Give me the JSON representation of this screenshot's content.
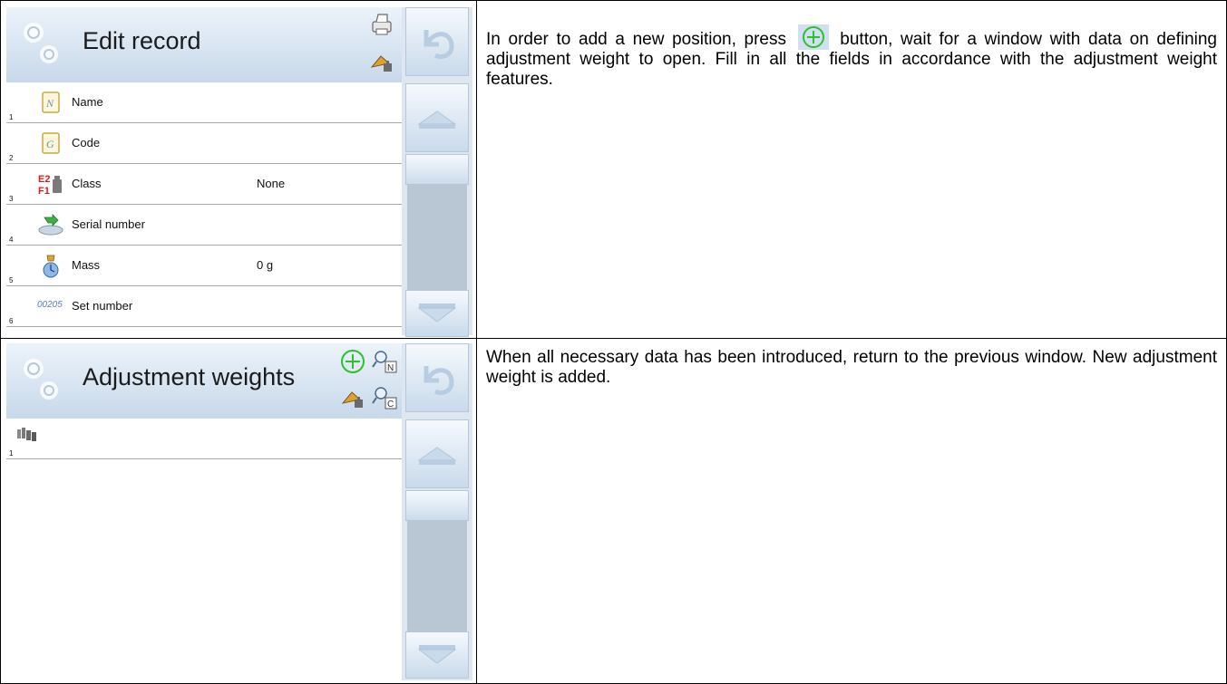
{
  "sections": [
    {
      "screen": {
        "title": "Edit record",
        "header_icons": [
          "printer-icon",
          "weights-settings-icon"
        ],
        "rows": [
          {
            "num": "1",
            "icon": "name-icon",
            "label": "Name",
            "value": ""
          },
          {
            "num": "2",
            "icon": "code-icon",
            "label": "Code",
            "value": ""
          },
          {
            "num": "3",
            "icon": "class-e2-f1-icon",
            "label": "Class",
            "value": "None"
          },
          {
            "num": "4",
            "icon": "serial-number-icon",
            "label": "Serial number",
            "value": ""
          },
          {
            "num": "5",
            "icon": "mass-icon",
            "label": "Mass",
            "value": "0 g"
          },
          {
            "num": "6",
            "icon": "set-number-icon",
            "prefix": "00205",
            "label": "Set number",
            "value": ""
          }
        ]
      },
      "text_before": "In order to add a new position, press",
      "text_after": "button, wait for a window with data on defining adjustment weight to open. Fill in all the fields in accordance with the adjustment weight features."
    },
    {
      "screen": {
        "title": "Adjustment weights",
        "header_icons": [
          "add-icon",
          "search-by-name-icon",
          "weights-settings-icon",
          "search-by-code-icon"
        ],
        "rows": [
          {
            "num": "1",
            "icon": "weights-set-icon",
            "label": "",
            "value": ""
          }
        ]
      },
      "text": "When all necessary data has been introduced, return to the previous window. New adjustment weight is added."
    }
  ],
  "colors": {
    "header_gradient_top": "#ecf3fa",
    "header_gradient_bottom": "#c7d8ea",
    "sidebar": "#dee6ef",
    "scroll_track": "#b9c7d4",
    "add_icon_green": "#2fbf2f"
  }
}
